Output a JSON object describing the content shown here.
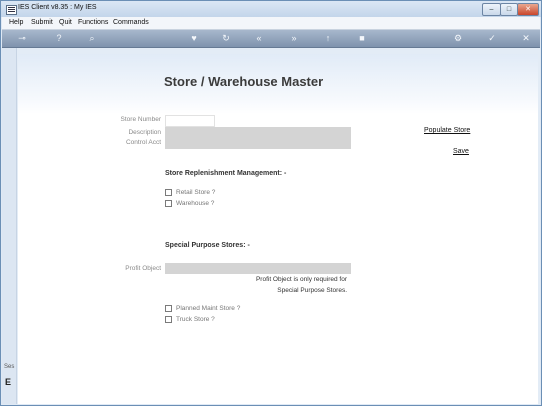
{
  "window": {
    "title": "IES Client v8.35 : My IES",
    "controls": {
      "minimize": "–",
      "maximize": "□",
      "close": "✕"
    }
  },
  "menu": [
    "Help",
    "Submit",
    "Quit",
    "Functions",
    "Commands"
  ],
  "toolbar": {
    "icons": [
      "key-icon",
      "help-icon",
      "search-icon",
      "heart-icon",
      "refresh-icon",
      "rewind-icon",
      "forward-icon",
      "upload-icon",
      "stop-icon",
      "gear-icon",
      "check-icon",
      "close-icon"
    ],
    "glyphs": [
      "⊸",
      "?",
      "⌕",
      "♥",
      "↻",
      "«",
      "»",
      "↑",
      "■",
      "⚙",
      "✓",
      "✕"
    ]
  },
  "form": {
    "title": "Store / Warehouse Master",
    "store_number_label": "Store Number",
    "store_number_value": "",
    "description_label": "Description",
    "description_value": "",
    "control_acct_label": "Control Acct",
    "control_acct_value": "",
    "populate_link": "Populate Store",
    "save_link": "Save",
    "replenishment_heading": "Store Replenishment Management: -",
    "retail_store_label": "Retail Store ?",
    "warehouse_label": "Warehouse ?",
    "special_heading": "Special Purpose Stores: -",
    "profit_object_label": "Profit Object",
    "profit_object_value": "",
    "profit_note_line1": "Profit Object is only required for",
    "profit_note_line2": "Special Purpose Stores.",
    "planned_maint_label": "Planned Maint Store ?",
    "truck_store_label": "Truck Store ?"
  },
  "sidebar": {
    "text": "Ses",
    "icon_glyph": "E"
  }
}
